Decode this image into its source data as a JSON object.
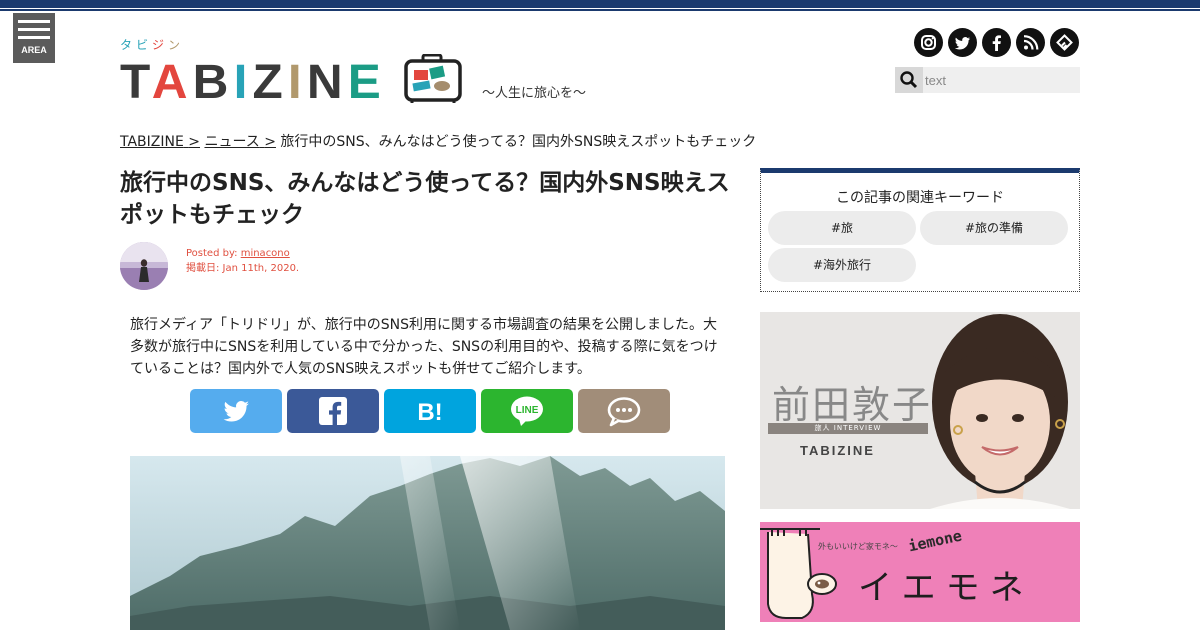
{
  "header": {
    "area_label": "AREA",
    "logo_kana": [
      "タ",
      "ビ",
      "ジ",
      "ン"
    ],
    "logo_text": "TABIZINE",
    "tagline": "～人生に旅心を～",
    "search_placeholder": "text",
    "social_icons": [
      "instagram-icon",
      "twitter-icon",
      "facebook-icon",
      "rss-icon",
      "feedly-icon"
    ],
    "brand_colors": {
      "navy": "#1b3a6e",
      "teal": "#28a3b7",
      "red": "#e3463e"
    }
  },
  "breadcrumb": {
    "home": "TABIZINE",
    "section": "ニュース",
    "sep": ">",
    "current": "旅行中のSNS、みんなはどう使ってる？国内外SNS映えスポットもチェック"
  },
  "article": {
    "title": "旅行中のSNS、みんなはどう使ってる？国内外SNS映えスポットもチェック",
    "posted_by_label": "Posted by:",
    "author": "minacono",
    "date": "掲載日: Jan 11th, 2020.",
    "lead": "旅行メディア「トリドリ」が、旅行中のSNS利用に関する市場調査の結果を公開しました。大多数が旅行中にSNSを利用している中で分かった、SNSの利用目的や、投稿する際に気をつけていることは？国内外で人気のSNS映えスポットも併せてご紹介します。",
    "share_buttons": [
      {
        "name": "twitter",
        "color": "#55acee"
      },
      {
        "name": "facebook",
        "color": "#3b5998"
      },
      {
        "name": "hatena",
        "color": "#00a4de"
      },
      {
        "name": "line",
        "color": "#2cb52f"
      },
      {
        "name": "comment",
        "color": "#a18d79"
      }
    ]
  },
  "sidebar": {
    "keywords_title": "この記事の関連キーワード",
    "keywords": [
      "#旅",
      "#旅の準備",
      "#海外旅行"
    ],
    "banner1": {
      "name": "前田敦子",
      "sub": "旅人 INTERVIEW",
      "logo": "TABIZINE"
    },
    "banner2": {
      "small": "外もいいけど家モネ〜",
      "script": "iemone",
      "big": "イエモネ"
    }
  }
}
